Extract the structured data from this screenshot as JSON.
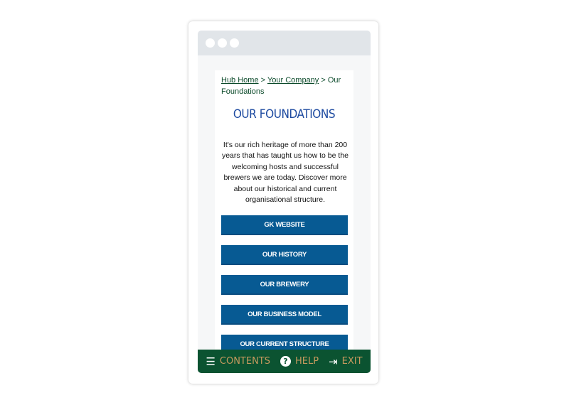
{
  "breadcrumb": {
    "home": "Hub Home",
    "sep1": ">",
    "company": "Your Company",
    "sep2": ">",
    "current": "Our Foundations"
  },
  "page_title": "OUR FOUNDATIONS",
  "intro": "It's our rich heritage of more than 200 years that has taught us how to be the welcoming hosts and successful brewers we are today. Discover more about our historical and current organisational structure.",
  "buttons": [
    "GK WEBSITE",
    "OUR HISTORY",
    "OUR BREWERY",
    "OUR BUSINESS MODEL",
    "OUR CURRENT STRUCTURE"
  ],
  "footer": {
    "contents": "CONTENTS",
    "help": "HELP",
    "exit": "EXIT",
    "help_icon": "?",
    "menu_icon": "☰",
    "exit_icon": "⇥"
  },
  "colors": {
    "button": "#075a93",
    "footer": "#0b5331",
    "title": "#1d4aa0",
    "footer_text": "#c79a5e"
  }
}
